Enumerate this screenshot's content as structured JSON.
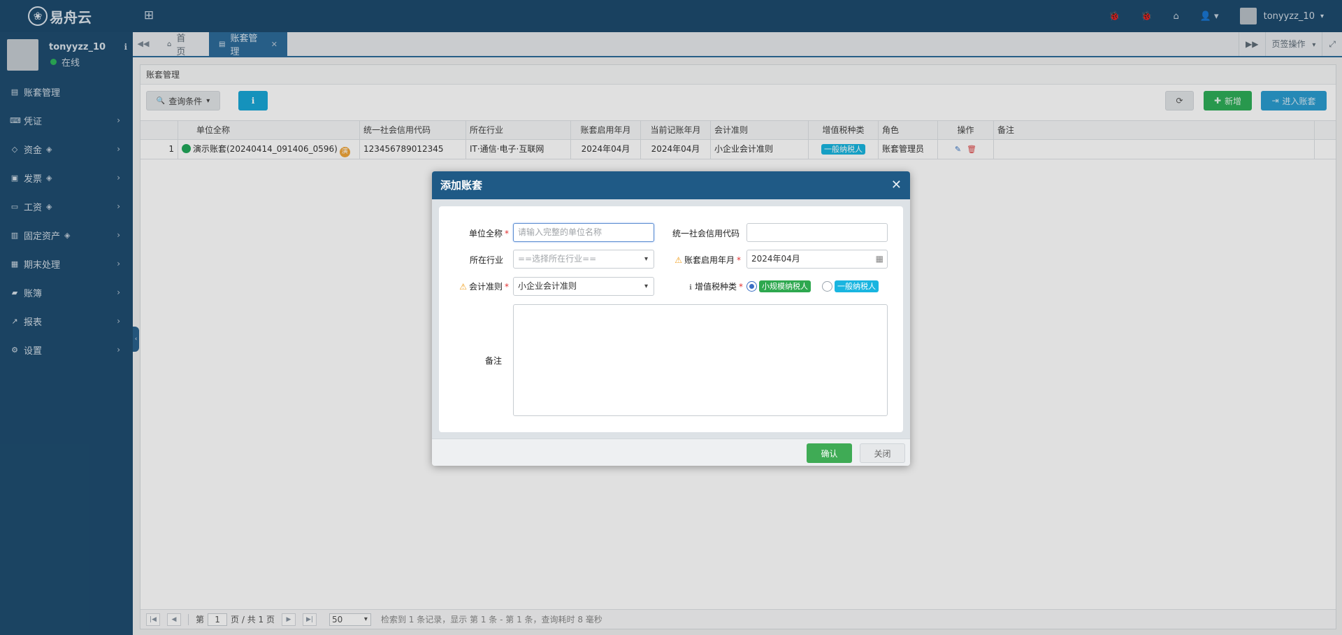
{
  "app": {
    "logo_text": "易舟云",
    "logo_mark": "❀"
  },
  "header": {
    "grid_icon": "⊞",
    "icons": [
      "🐞",
      "🐞",
      "⌂",
      "👤 ▾"
    ],
    "username": "tonyyzz_10",
    "username_caret": "▾"
  },
  "sidebar": {
    "profile": {
      "name": "tonyyzz_10",
      "status": "在线",
      "info_icon": "ℹ"
    },
    "menu": [
      {
        "icon": "▤",
        "label": "账套管理",
        "gem": "",
        "chevron": ""
      },
      {
        "icon": "⌨",
        "label": "凭证",
        "gem": "",
        "chevron": "›"
      },
      {
        "icon": "◇",
        "label": "资金",
        "gem": "◈",
        "chevron": "›"
      },
      {
        "icon": "▣",
        "label": "发票",
        "gem": "◈",
        "chevron": "›"
      },
      {
        "icon": "▭",
        "label": "工资",
        "gem": "◈",
        "chevron": "›"
      },
      {
        "icon": "▥",
        "label": "固定资产",
        "gem": "◈",
        "chevron": "›"
      },
      {
        "icon": "▦",
        "label": "期末处理",
        "gem": "",
        "chevron": "›"
      },
      {
        "icon": "▰",
        "label": "账簿",
        "gem": "",
        "chevron": "›"
      },
      {
        "icon": "↗",
        "label": "报表",
        "gem": "",
        "chevron": "›"
      },
      {
        "icon": "⚙",
        "label": "设置",
        "gem": "",
        "chevron": "›"
      }
    ],
    "collapse_icon": "‹"
  },
  "tabs": {
    "prev_icon": "◀◀",
    "home": {
      "icon": "⌂",
      "label": "首页"
    },
    "active": {
      "icon": "▤",
      "label": "账套管理",
      "close": "✕"
    },
    "next_icon": "▶▶",
    "tab_ops_label": "页签操作",
    "tab_ops_caret": "▾",
    "fullscreen_icon": "⤢"
  },
  "panel": {
    "title": "账套管理",
    "query_label": "查询条件",
    "query_icon": "🔍",
    "query_caret": "▾",
    "info_icon": "ℹ",
    "refresh_icon": "⟳",
    "new_label": "新增",
    "new_icon": "✚",
    "enter_label": "进入账套",
    "enter_icon": "⇥"
  },
  "grid": {
    "columns": [
      "",
      "单位全称",
      "统一社会信用代码",
      "所在行业",
      "账套启用年月",
      "当前记账年月",
      "会计准则",
      "增值税种类",
      "角色",
      "操作",
      "备注"
    ],
    "rows": [
      {
        "index": "1",
        "name": "演示账套(20240414_091406_0596)",
        "demo_badge": "演",
        "credit_code": "123456789012345",
        "industry": "IT·通信·电子·互联网",
        "start_month": "2024年04月",
        "current_month": "2024年04月",
        "standard": "小企业会计准则",
        "tax_type": "一般纳税人",
        "role": "账套管理员",
        "edit_icon": "✎",
        "delete_icon": "🗑",
        "remark": ""
      }
    ]
  },
  "pager": {
    "first": "|◀",
    "prev": "◀",
    "page_prefix": "第",
    "page_value": "1",
    "page_suffix": "页 / 共 1 页",
    "next": "▶",
    "last": "▶|",
    "page_size": "50",
    "summary": "检索到 1 条记录，显示 第 1 条 - 第 1 条，查询耗时 8 毫秒"
  },
  "modal": {
    "title": "添加账套",
    "close_icon": "✕",
    "fields": {
      "name_label": "单位全称",
      "name_placeholder": "请输入完整的单位名称",
      "credit_label": "统一社会信用代码",
      "credit_value": "",
      "industry_label": "所在行业",
      "industry_placeholder": "==选择所在行业==",
      "start_label": "账套启用年月",
      "start_value": "2024年04月",
      "standard_label": "会计准则",
      "standard_value": "小企业会计准则",
      "tax_label": "增值税种类",
      "tax_option_small": "小规模纳税人",
      "tax_option_general": "一般纳税人",
      "remark_label": "备注"
    },
    "required_mark": "*",
    "warn_icon": "⚠",
    "info_icon": "ℹ",
    "caret": "▾",
    "calendar_icon": "▦",
    "confirm_label": "确认",
    "close_label": "关闭"
  }
}
